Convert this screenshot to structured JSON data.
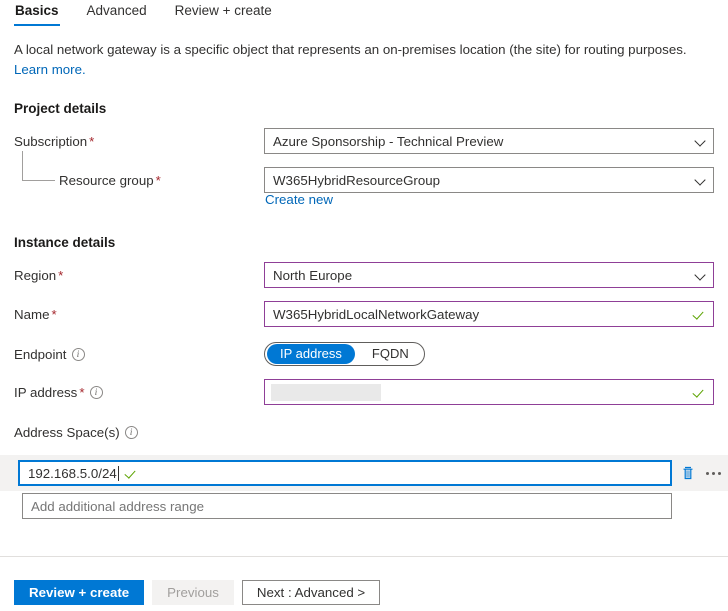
{
  "tabs": [
    {
      "label": "Basics",
      "active": true
    },
    {
      "label": "Advanced",
      "active": false
    },
    {
      "label": "Review + create",
      "active": false
    }
  ],
  "description": {
    "text": "A local network gateway is a specific object that represents an on-premises location (the site) for routing purposes. ",
    "link": "Learn more."
  },
  "sections": {
    "project_details": "Project details",
    "instance_details": "Instance details"
  },
  "fields": {
    "subscription": {
      "label": "Subscription",
      "required": "*",
      "value": "Azure Sponsorship - Technical Preview"
    },
    "resource_group": {
      "label": "Resource group",
      "required": "*",
      "value": "W365HybridResourceGroup",
      "create_new": "Create new"
    },
    "region": {
      "label": "Region",
      "required": "*",
      "value": "North Europe"
    },
    "name": {
      "label": "Name",
      "required": "*",
      "value": "W365HybridLocalNetworkGateway"
    },
    "endpoint": {
      "label": "Endpoint",
      "options": [
        "IP address",
        "FQDN"
      ],
      "selected": "IP address"
    },
    "ip_address": {
      "label": "IP address",
      "required": "*",
      "value": ""
    },
    "address_space": {
      "label": "Address Space(s)",
      "value": "192.168.5.0/24",
      "placeholder": "Add additional address range"
    }
  },
  "footer": {
    "review_create": "Review + create",
    "previous": "Previous",
    "next": "Next : Advanced  >"
  },
  "colors": {
    "accent": "#0078d4",
    "link": "#0067b8",
    "required": "#a4262c",
    "validated_border": "#8f3f97",
    "valid_check": "#5ba300"
  }
}
